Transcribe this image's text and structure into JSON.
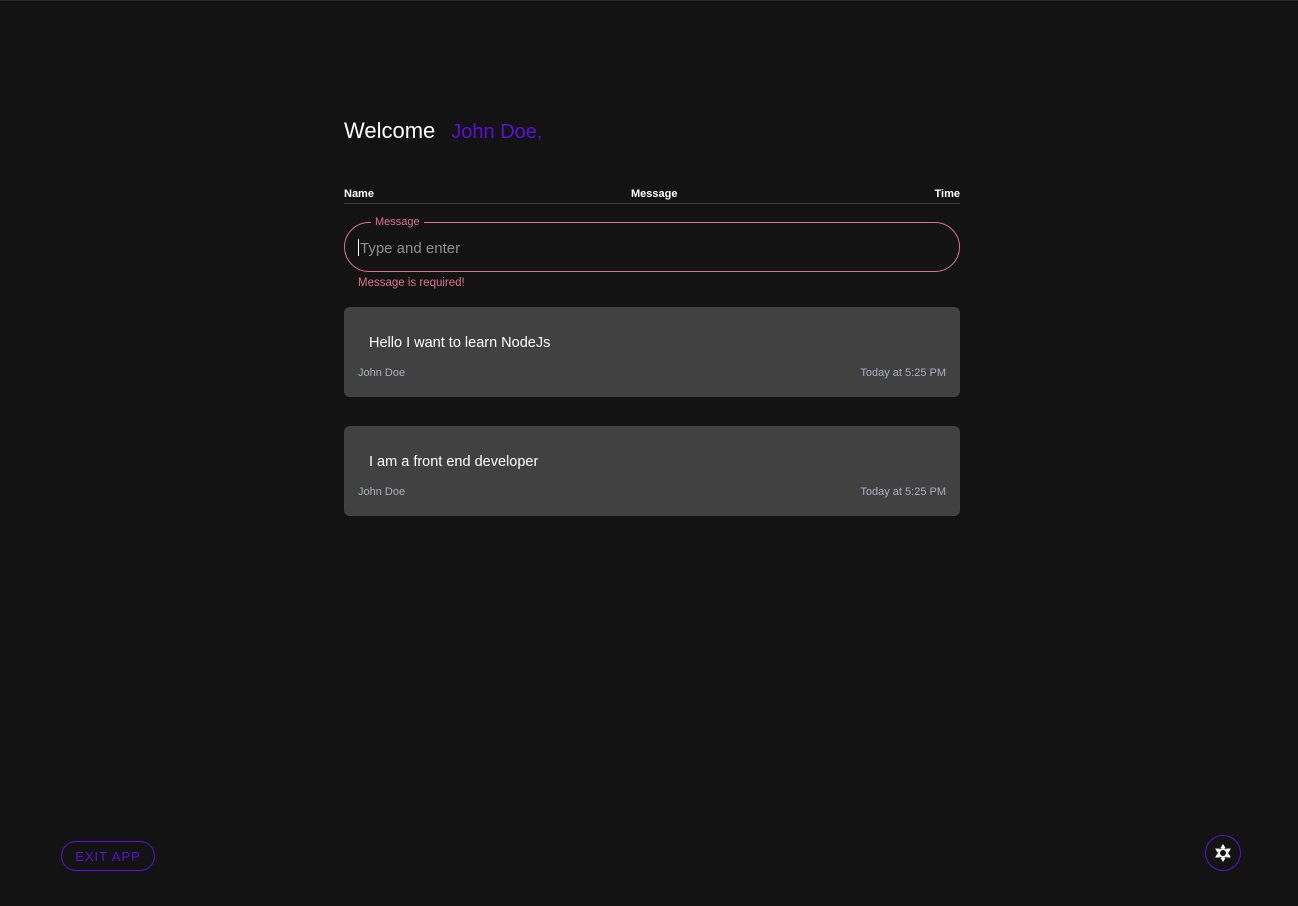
{
  "greeting": {
    "label": "Welcome",
    "user": "John Doe,"
  },
  "table_header": {
    "name": "Name",
    "message": "Message",
    "time": "Time"
  },
  "message_field": {
    "legend": "Message",
    "placeholder": "Type and enter",
    "value": "",
    "error": "Message is required!"
  },
  "messages": [
    {
      "text": "Hello I want to learn NodeJs",
      "author": "John Doe",
      "time": "Today at 5:25 PM"
    },
    {
      "text": "I am a front end developer",
      "author": "John Doe",
      "time": "Today at 5:25 PM"
    }
  ],
  "actions": {
    "exit_label": "EXIT APP",
    "theme_icon": "theme-toggle-icon"
  },
  "colors": {
    "background": "#131313",
    "accent": "#5b0fd6",
    "error": "#e0708f",
    "card": "#414141"
  }
}
